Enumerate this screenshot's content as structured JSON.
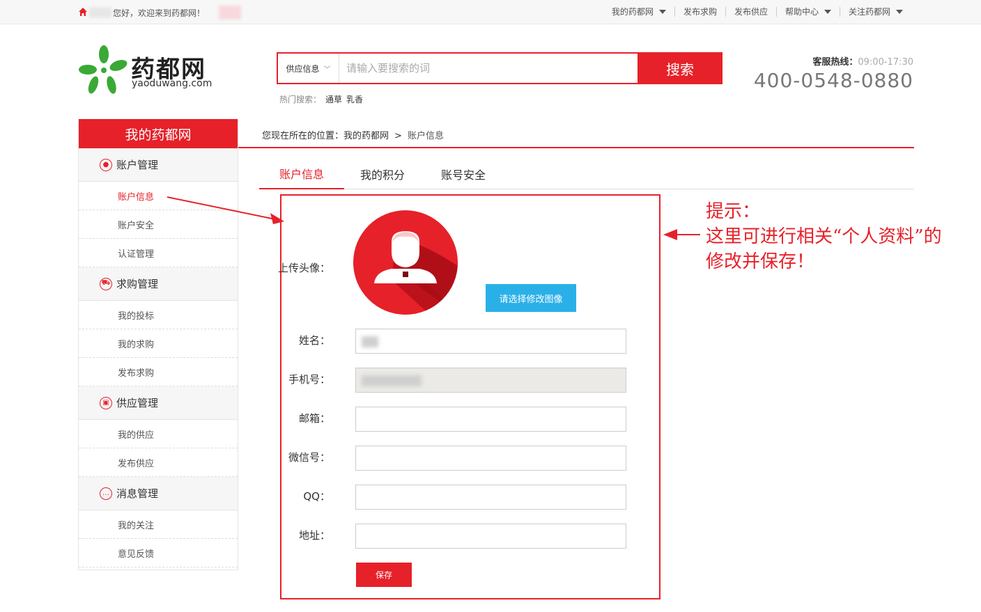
{
  "topbar": {
    "welcome": "您好，欢迎来到药都网！",
    "nav": [
      {
        "label": "我的药都网",
        "dropdown": true
      },
      {
        "label": "发布求购",
        "dropdown": false
      },
      {
        "label": "发布供应",
        "dropdown": false
      },
      {
        "label": "帮助中心",
        "dropdown": true
      },
      {
        "label": "关注药都网",
        "dropdown": true
      }
    ]
  },
  "header": {
    "logo_name": "药都网",
    "logo_url": "yaoduwang.com",
    "search_category": "供应信息",
    "search_placeholder": "请输入要搜索的词",
    "search_button": "搜索",
    "hot_label": "热门搜索：",
    "hot_words": [
      "通草",
      "乳香"
    ],
    "hotline_label": "客服热线：",
    "hotline_time": "09:00-17:30",
    "hotline_number": "400-0548-0880"
  },
  "sidebar": {
    "title": "我的药都网",
    "groups": [
      {
        "label": "账户管理",
        "items": [
          "账户信息",
          "账户安全",
          "认证管理"
        ]
      },
      {
        "label": "求购管理",
        "items": [
          "我的投标",
          "我的求购",
          "发布求购"
        ]
      },
      {
        "label": "供应管理",
        "items": [
          "我的供应",
          "发布供应"
        ]
      },
      {
        "label": "消息管理",
        "items": [
          "我的关注",
          "意见反馈"
        ]
      }
    ],
    "active_item": "账户信息"
  },
  "breadcrumb": {
    "prefix": "您现在所在的位置：",
    "root": "我的药都网",
    "separator": ">",
    "current": "账户信息"
  },
  "tabs": [
    "账户信息",
    "我的积分",
    "账号安全"
  ],
  "form": {
    "avatar_label": "上传头像：",
    "upload_button": "请选择修改图像",
    "name_label": "姓名：",
    "phone_label": "手机号：",
    "email_label": "邮箱：",
    "wechat_label": "微信号：",
    "qq_label": "QQ：",
    "address_label": "地址：",
    "email_value": "",
    "wechat_value": "",
    "qq_value": "",
    "address_value": "",
    "save_button": "保存"
  },
  "annotation": {
    "line1": "提示：",
    "line2": "这里可进行相关“个人资料”的",
    "line3": "修改并保存！"
  },
  "colors": {
    "brand_red": "#e62129",
    "upload_blue": "#2ab0e8",
    "logo_green": "#3aa935"
  }
}
